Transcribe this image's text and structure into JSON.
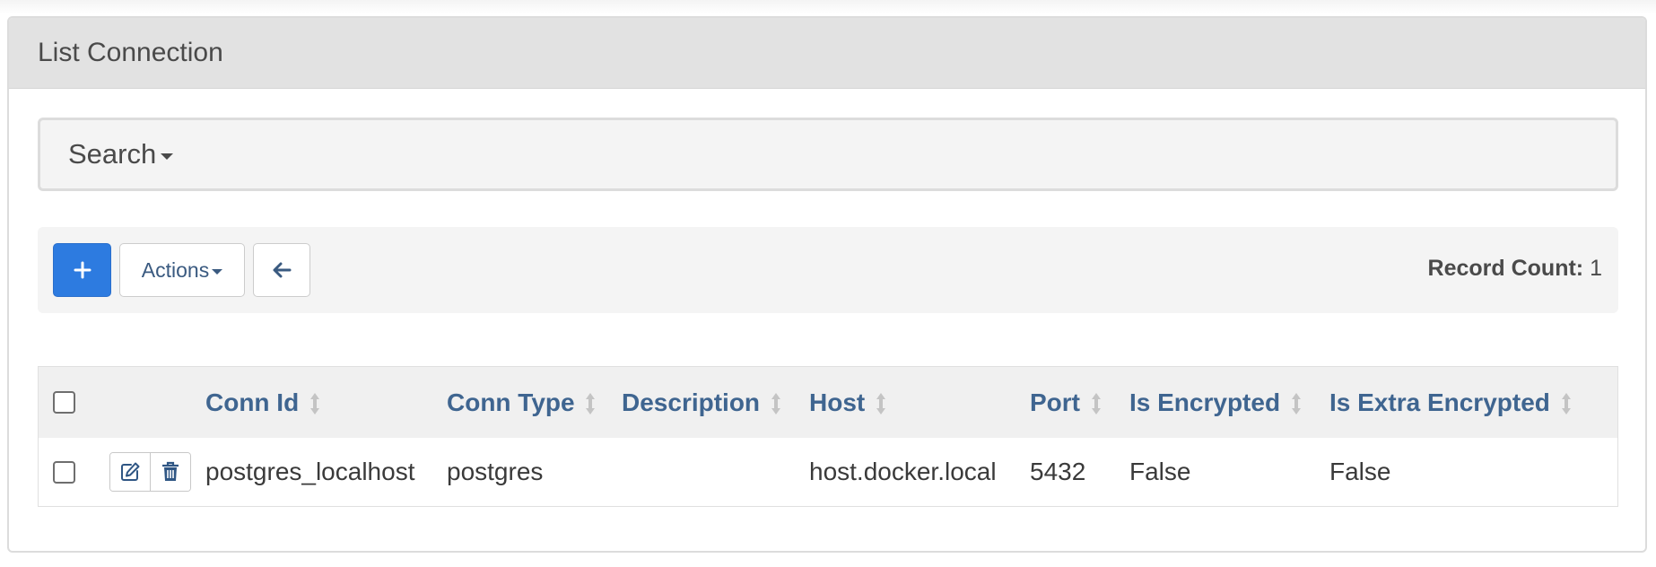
{
  "panel": {
    "title": "List Connection"
  },
  "search": {
    "label": "Search"
  },
  "toolbar": {
    "add_icon": "plus-icon",
    "actions_label": "Actions",
    "back_icon": "arrow-left-icon",
    "record_count_label": "Record Count:",
    "record_count_value": "1"
  },
  "table": {
    "columns": [
      "Conn Id",
      "Conn Type",
      "Description",
      "Host",
      "Port",
      "Is Encrypted",
      "Is Extra Encrypted"
    ],
    "rows": [
      {
        "conn_id": "postgres_localhost",
        "conn_type": "postgres",
        "description": "",
        "host": "host.docker.local",
        "port": "5432",
        "is_encrypted": "False",
        "is_extra_encrypted": "False"
      }
    ],
    "row_action_icons": [
      "edit-icon",
      "trash-icon"
    ]
  },
  "colors": {
    "primary": "#2d7be0",
    "header_link": "#3f6590",
    "panel_heading_bg": "#e2e2e2",
    "toolbar_bg": "#f4f4f4"
  }
}
